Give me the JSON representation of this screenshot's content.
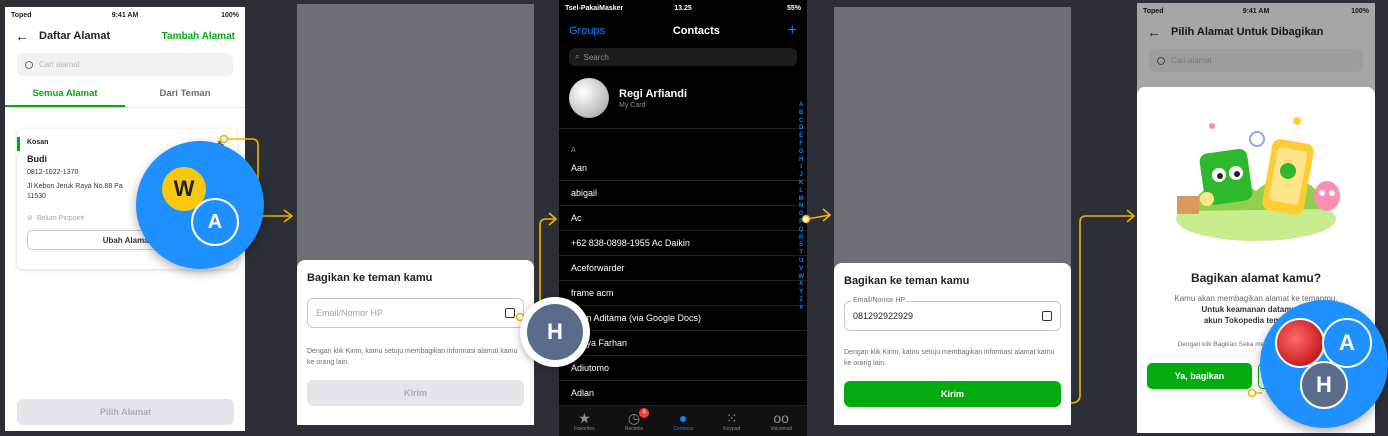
{
  "screen1": {
    "status": {
      "carrier": "Toped",
      "time": "9:41 AM",
      "battery": "100%"
    },
    "title": "Daftar Alamat",
    "action": "Tambah Alamat",
    "search_placeholder": "Cari alamat",
    "tabs": [
      "Semua Alamat",
      "Dari Teman"
    ],
    "card": {
      "tag": "Kosan",
      "name": "Budi",
      "phone": "0812-1022-1370",
      "address": "Jl Kebon Jeruk Raya No.88 Pa",
      "postcode": "11530",
      "pinpoint": "Belum Pinpoint",
      "edit_button": "Ubah Alamat"
    },
    "footer_button": "Pilih Alamat"
  },
  "screen2": {
    "sheet_title": "Bagikan ke teman kamu",
    "field_placeholder": "Email/Nomor HP",
    "note": "Dengan klik Kirim, kamu setuju membagikan informasi alamat kamu ke orang lain.",
    "button": "Kirim"
  },
  "screen3": {
    "status": {
      "carrier": "Tsel-PakaiMasker",
      "time": "13.25",
      "battery": "55%"
    },
    "groups": "Groups",
    "title": "Contacts",
    "add": "+",
    "search": "Search",
    "my_card": {
      "name": "Regi Arfiandi",
      "sub": "My Card"
    },
    "section": "A",
    "contacts": [
      "Aan",
      "abigail",
      "Ac",
      "+62 838-0898-1955 Ac Daikin",
      "Aceforwarder",
      "frame acm",
      "Adim Aditama (via Google Docs)",
      "Aditya Farhan",
      "Adiutomo",
      "Adlan"
    ],
    "index": [
      "A",
      "B",
      "C",
      "D",
      "E",
      "F",
      "G",
      "H",
      "I",
      "J",
      "K",
      "L",
      "M",
      "N",
      "O",
      "P",
      "Q",
      "R",
      "S",
      "T",
      "U",
      "V",
      "W",
      "X",
      "Y",
      "Z",
      "#"
    ],
    "tabbar": [
      "Favorites",
      "Recents",
      "Contacts",
      "Keypad",
      "Voicemail"
    ],
    "recents_badge": "4"
  },
  "screen4": {
    "sheet_title": "Bagikan ke teman kamu",
    "field_label": "Email/Nomor HP",
    "field_value": "081292922929",
    "note": "Dengan klik Kirim, kamu setuju membagikan informasi alamat kamu ke orang lain.",
    "button": "Kirim"
  },
  "screen5": {
    "status": {
      "carrier": "Toped",
      "time": "9:41 AM",
      "battery": "100%"
    },
    "title": "Pilih Alamat Untuk Dibagikan",
    "search_placeholder": "Cari alamat",
    "modal_title": "Bagikan alamat kamu?",
    "modal_body_1": "Kamu akan membagikan alamat ke temanmu.",
    "modal_body_bold": "Untuk keamanan datamu, Pa",
    "modal_body_2": "akun Tokopedia teman kam",
    "modal_note": "Dengan klik Bagikan Seka membagikan alamat sesuai",
    "yes_button": "Ya, bagikan",
    "no_button": ""
  },
  "avatars": {
    "w": "W",
    "a1": "A",
    "h1": "H",
    "a2": "A",
    "h2": "H"
  },
  "colors": {
    "accent": "#03ac0e",
    "ios_blue": "#0a84ff",
    "connector": "#f5b400",
    "avatar_blue": "#1e90ff"
  }
}
